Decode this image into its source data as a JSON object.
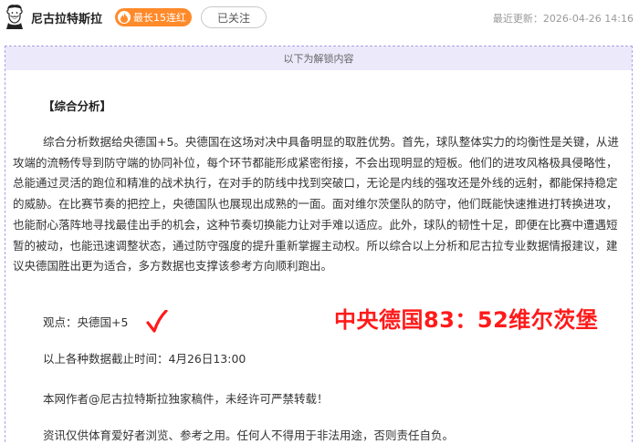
{
  "header": {
    "author": "尼古拉特斯拉",
    "streak_badge": "最长15连红",
    "follow_label": "已关注",
    "updated": "最近更新：2026-04-26 14:16"
  },
  "card": {
    "banner": "以下为解锁内容",
    "section_title": "【综合分析】",
    "analysis": "综合分析数据给央德国+5。央德国在这场对决中具备明显的取胜优势。首先，球队整体实力的均衡性是关键，从进攻端的流畅传导到防守端的协同补位，每个环节都能形成紧密衔接，不会出现明显的短板。他们的进攻风格极具侵略性，总能通过灵活的跑位和精准的战术执行，在对手的防线中找到突破口，无论是内线的强攻还是外线的远射，都能保持稳定的威胁。在比赛节奏的把控上，央德国队也展现出成熟的一面。面对维尔茨堡队的防守，他们既能快速推进打转换进攻，也能耐心落阵地寻找最佳出手的机会，这种节奏切换能力让对手难以适应。此外，球队的韧性十足，即便在比赛中遭遇短暂的被动，也能迅速调整状态，通过防守强度的提升重新掌握主动权。所以综合以上分析和尼古拉专业数据情报建议，建议央德国胜出更为适合，多方数据也支撑该参考方向顺利跑出。",
    "viewpoint": "观点：央德国+5",
    "data_cutoff": "以上各种数据截止时间：4月26日13:00",
    "copyright": "本网作者@尼古拉特斯拉独家稿件，未经许可严禁转载！",
    "disclaimer": "资讯仅供体育爱好者浏览、参考之用。任何人不得用于非法用途，否则责任自负。",
    "final_score": "中央德国83：52维尔茨堡"
  },
  "colors": {
    "streak": "#ff8a2a",
    "banner_bg": "#ece9fb",
    "card_border": "#a9a0e8",
    "score": "#ff1a1a"
  }
}
